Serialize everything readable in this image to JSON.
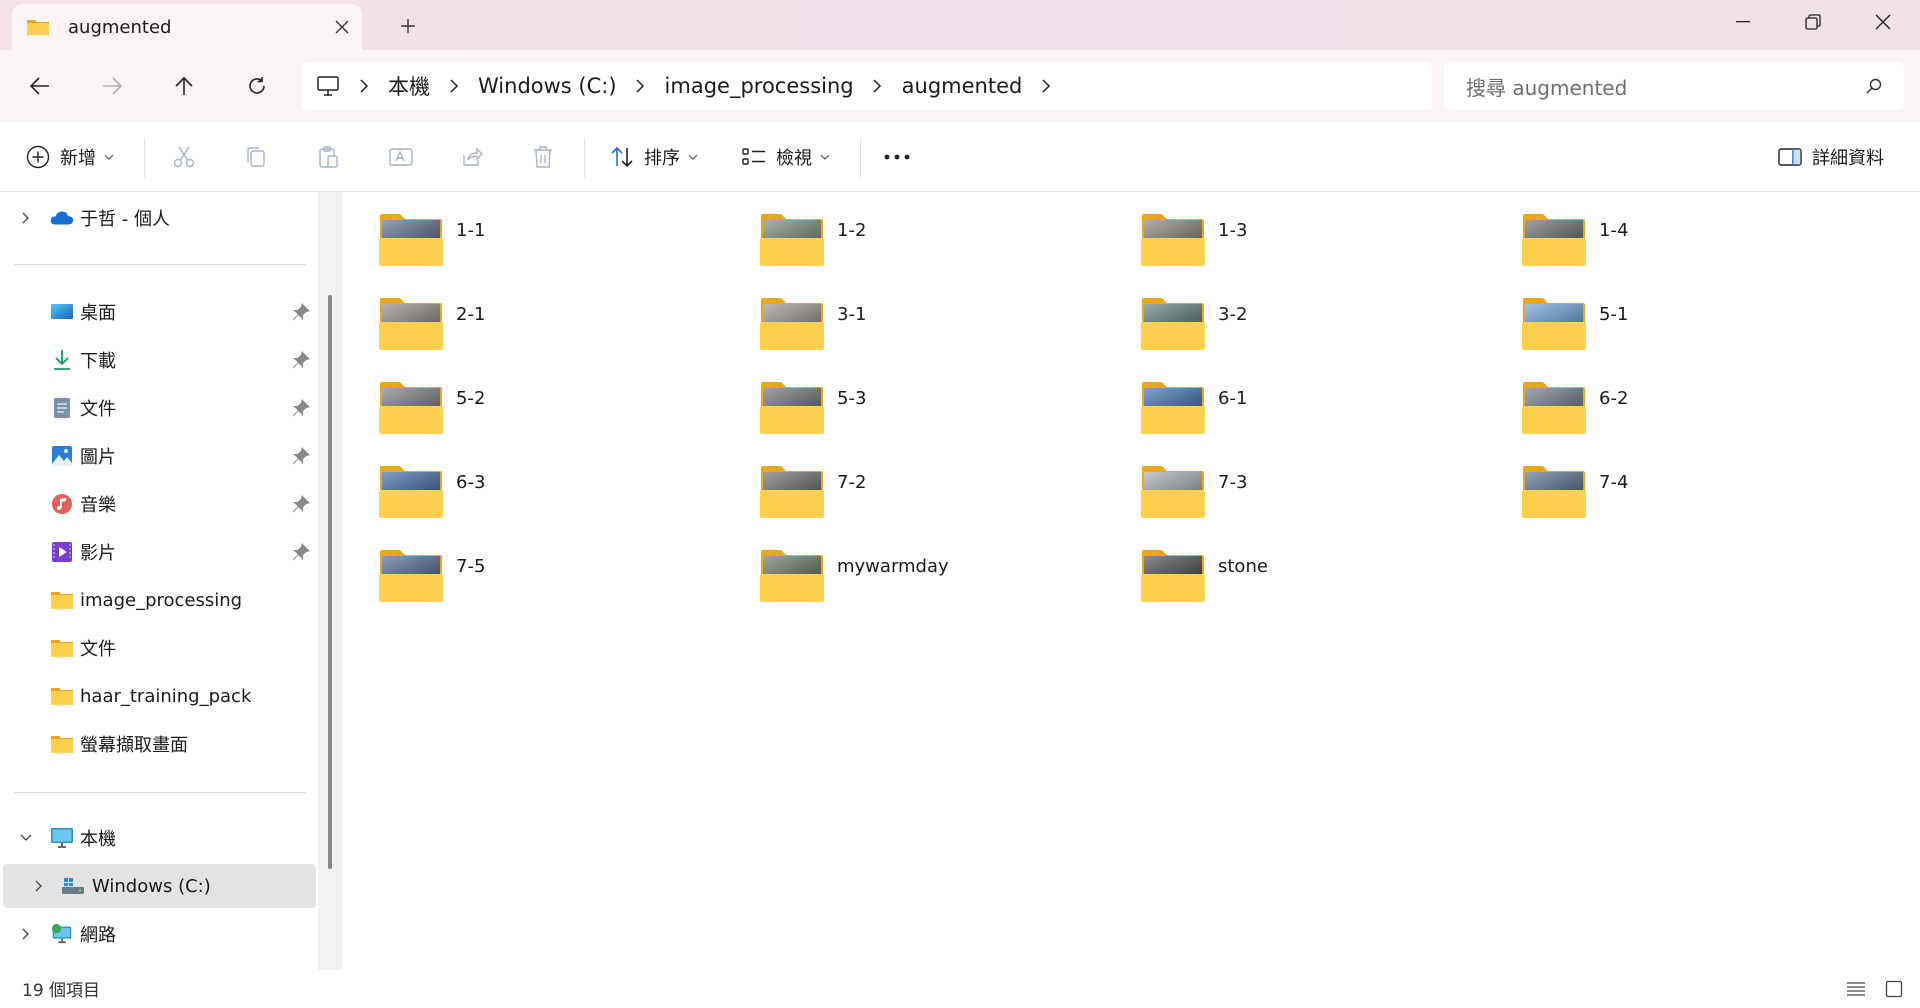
{
  "window": {
    "tab_title": "augmented",
    "controls": {
      "minimize": "minimize-icon",
      "maximize": "restore-icon",
      "close": "close-icon"
    }
  },
  "address": {
    "crumbs": [
      "本機",
      "Windows (C:)",
      "image_processing",
      "augmented"
    ],
    "search_placeholder": "搜尋 augmented"
  },
  "commands": {
    "new": "新增",
    "sort": "排序",
    "view": "檢視",
    "details": "詳細資料"
  },
  "sidebar": {
    "onedrive": "于哲 - 個人",
    "quick": [
      {
        "label": "桌面",
        "icon": "desktop-icon"
      },
      {
        "label": "下載",
        "icon": "download-icon"
      },
      {
        "label": "文件",
        "icon": "document-icon"
      },
      {
        "label": "圖片",
        "icon": "pictures-icon"
      },
      {
        "label": "音樂",
        "icon": "music-icon"
      },
      {
        "label": "影片",
        "icon": "video-icon"
      },
      {
        "label": "image_processing",
        "icon": "folder-icon"
      },
      {
        "label": "文件",
        "icon": "folder-icon"
      },
      {
        "label": "haar_training_pack",
        "icon": "folder-icon"
      },
      {
        "label": "螢幕擷取畫面",
        "icon": "folder-icon"
      }
    ],
    "this_pc": "本機",
    "drive_c": "Windows (C:)",
    "network": "網路"
  },
  "folders": [
    {
      "name": "1-1",
      "tint": "#5a6f86"
    },
    {
      "name": "1-2",
      "tint": "#7c8a7a"
    },
    {
      "name": "1-3",
      "tint": "#8a8379"
    },
    {
      "name": "1-4",
      "tint": "#6c6f6e"
    },
    {
      "name": "2-1",
      "tint": "#8e8a86"
    },
    {
      "name": "3-1",
      "tint": "#9a968f"
    },
    {
      "name": "3-2",
      "tint": "#5e7d7a"
    },
    {
      "name": "5-1",
      "tint": "#6aa3d9"
    },
    {
      "name": "5-2",
      "tint": "#7a7d80"
    },
    {
      "name": "5-3",
      "tint": "#6f7174"
    },
    {
      "name": "6-1",
      "tint": "#3f6fae"
    },
    {
      "name": "6-2",
      "tint": "#707a82"
    },
    {
      "name": "6-3",
      "tint": "#3d6aa8"
    },
    {
      "name": "7-2",
      "tint": "#6a6c6e"
    },
    {
      "name": "7-3",
      "tint": "#a9adb1"
    },
    {
      "name": "7-4",
      "tint": "#55708c"
    },
    {
      "name": "7-5",
      "tint": "#4f6a8c"
    },
    {
      "name": "mywarmday",
      "tint": "#6b7564"
    },
    {
      "name": "stone",
      "tint": "#4a4b4d"
    }
  ],
  "status": {
    "item_count": "19 個項目"
  },
  "colors": {
    "folder_yellow": "#ffd04d",
    "folder_back": "#e8a818",
    "accent_blue": "#1e6fd9"
  }
}
